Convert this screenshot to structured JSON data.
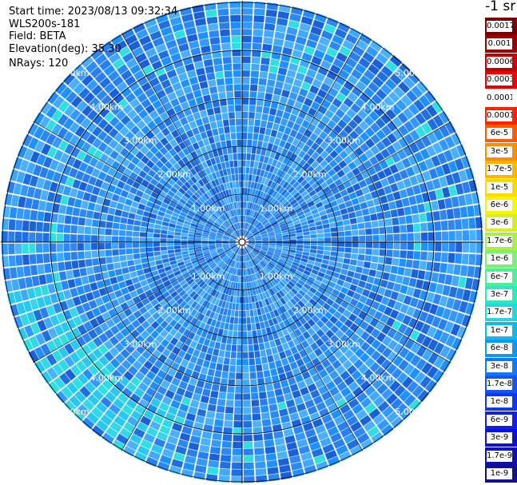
{
  "header": {
    "start_time": "Start time: 2023/08/13 09:32:34",
    "instrument": "WLS200s-181",
    "field": "Field: BETA",
    "elevation": "Elevation(deg): 35.30",
    "nrays": "NRays: 120",
    "unit": "-1 sr"
  },
  "range_labels": [
    "1.00km",
    "2.00km",
    "3.00km",
    "4.00km",
    "5.00km"
  ],
  "colorbar": {
    "labels": [
      "0.0017",
      "0.001",
      "0.0006",
      "0.0003",
      "0.00017",
      "0.0001",
      "6e-5",
      "3e-5",
      "1.7e-5",
      "1e-5",
      "6e-6",
      "3e-6",
      "1.7e-6",
      "1e-6",
      "6e-7",
      "3e-7",
      "1.7e-7",
      "1e-7",
      "6e-8",
      "3e-8",
      "1.7e-8",
      "1e-8",
      "6e-9",
      "3e-9",
      "1.7e-9",
      "1e-9"
    ],
    "colors": [
      "#7a0000",
      "#9e0000",
      "#c40000",
      "#ee0000",
      "#ffffff",
      "#ff2200",
      "#ff5a00",
      "#ff8c00",
      "#ffb400",
      "#ffd800",
      "#f6f600",
      "#d4f020",
      "#a8f048",
      "#7cf070",
      "#50ee98",
      "#30e8c0",
      "#20d8e0",
      "#10b8f0",
      "#1098f0",
      "#1078f0",
      "#1058f0",
      "#1038f0",
      "#1020e8",
      "#1010d0",
      "#1010b0",
      "#101090"
    ]
  }
}
